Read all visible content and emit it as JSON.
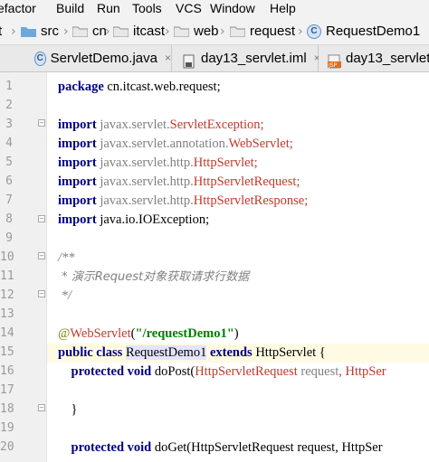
{
  "menu": [
    "efactor",
    "Build",
    "Run",
    "Tools",
    "VCS",
    "Window",
    "Help"
  ],
  "breadcrumb": {
    "items": [
      "t",
      "src",
      "cn",
      "itcast",
      "web",
      "request",
      "RequestDemo1"
    ]
  },
  "tabs": [
    {
      "label": "ServletDemo.java",
      "close": "×"
    },
    {
      "label": "day13_servlet.iml",
      "close": "×"
    },
    {
      "label": "day13_servlet\\",
      "close": ""
    }
  ],
  "line_numbers": [
    "1",
    "2",
    "3",
    "4",
    "5",
    "6",
    "7",
    "8",
    "9",
    "10",
    "11",
    "12",
    "13",
    "14",
    "15",
    "16",
    "17",
    "18",
    "19",
    "20"
  ],
  "code": {
    "l1": {
      "kw": "package",
      "rest": " cn.itcast.web.request;"
    },
    "l3": {
      "kw": "import",
      "pkg": " javax.servlet.",
      "cls": "ServletException",
      "semi": ";"
    },
    "l4": {
      "kw": "import",
      "pkg": " javax.servlet.annotation.",
      "cls": "WebServlet",
      "semi": ";"
    },
    "l5": {
      "kw": "import",
      "pkg": " javax.servlet.http.",
      "cls": "HttpServlet",
      "semi": ";"
    },
    "l6": {
      "kw": "import",
      "pkg": " javax.servlet.http.",
      "cls": "HttpServletRequest",
      "semi": ";"
    },
    "l7": {
      "kw": "import",
      "pkg": " javax.servlet.http.",
      "cls": "HttpServletResponse",
      "semi": ";"
    },
    "l8": {
      "kw": "import",
      "rest": " java.io.IOException;"
    },
    "l10": "/**",
    "l11": " * 演示Request对象获取请求行数据",
    "l12": " */",
    "l14": {
      "at": "@",
      "anno": "WebServlet",
      "open": "(",
      "str": "\"/requestDemo1\"",
      "close": ")"
    },
    "l15": {
      "kw1": "public class ",
      "cls": "RequestDemo1",
      "kw2": " extends",
      "rest": " HttpServlet {"
    },
    "l16": {
      "kw": "    protected void",
      "name": " doPost(",
      "type": "HttpServletRequest",
      "param": " request",
      "tail": ", HttpSer"
    },
    "l18": "    }",
    "l20": {
      "kw": "    protected void",
      "name": " doGet(",
      "rest": "HttpServletRequest request, HttpSer"
    }
  }
}
